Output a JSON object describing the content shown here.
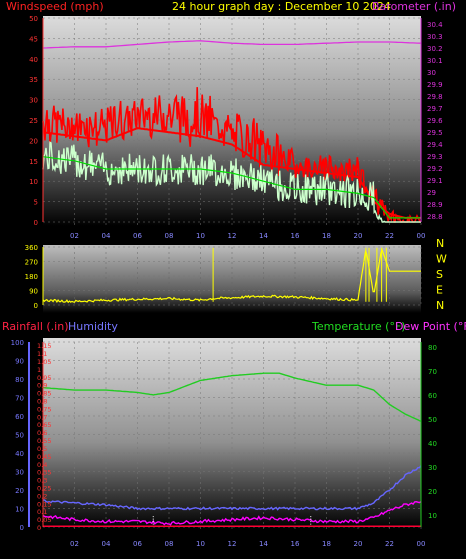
{
  "header": {
    "left_label": "Windspeed (mph)",
    "center_label": "24 hour graph day : December 10 2024",
    "right_label": "Barometer (.in)"
  },
  "colors": {
    "windspeed": "#ff0000",
    "gust": "#ff0000",
    "wind_avg": "#ccffcc",
    "wind_avg2": "#00dd00",
    "barometer": "#dd33dd",
    "direction": "#ffff00",
    "temperature": "#22cc22",
    "humidity": "#6666ff",
    "rainfall": "#ff0033",
    "dewpoint": "#ff00ff",
    "header_yellow": "#ffff00"
  },
  "chart_data": [
    {
      "type": "line",
      "x_ticks": [
        "02",
        "04",
        "06",
        "08",
        "10",
        "12",
        "14",
        "16",
        "18",
        "20",
        "22",
        "00"
      ],
      "left_axis": {
        "ticks": [
          0,
          5,
          10,
          15,
          20,
          25,
          30,
          35,
          40,
          45,
          50
        ],
        "range": [
          0,
          50
        ],
        "label": "Windspeed (mph)"
      },
      "right_axis": {
        "ticks": [
          "28.8",
          "28.9",
          "29",
          "29.1",
          "29.2",
          "29.3",
          "29.4",
          "29.5",
          "29.6",
          "29.7",
          "29.8",
          "29.9",
          "30",
          "30.1",
          "30.2",
          "30.3",
          "30.4"
        ],
        "range": [
          28.75,
          30.45
        ],
        "label": "Barometer (.in)"
      },
      "series": [
        {
          "name": "Windspeed (mph)",
          "hours": [
            0,
            2,
            4,
            6,
            8,
            10,
            12,
            14,
            16,
            18,
            20,
            21,
            22,
            23,
            24
          ],
          "values": [
            22,
            21,
            20,
            23,
            22,
            21,
            19,
            14,
            13,
            12,
            11,
            5,
            2,
            1,
            1
          ],
          "gust": [
            31,
            28,
            30,
            32,
            34,
            33,
            28,
            25,
            18,
            17,
            17,
            12,
            4,
            2,
            2
          ]
        },
        {
          "name": "Avg",
          "hours": [
            0,
            2,
            4,
            6,
            8,
            10,
            12,
            14,
            16,
            18,
            20,
            21,
            22,
            23,
            24
          ],
          "values": [
            16,
            15,
            13,
            13,
            13,
            13,
            12,
            10,
            8,
            8,
            7,
            6,
            1,
            1,
            1
          ]
        },
        {
          "name": "Barometer (.in)",
          "hours": [
            0,
            2,
            4,
            6,
            8,
            10,
            12,
            14,
            16,
            18,
            20,
            22,
            24
          ],
          "values": [
            30.2,
            30.21,
            30.21,
            30.23,
            30.25,
            30.26,
            30.24,
            30.23,
            30.23,
            30.24,
            30.25,
            30.25,
            30.24
          ]
        }
      ]
    },
    {
      "type": "line",
      "x_ticks": [],
      "left_axis": {
        "ticks": [
          0,
          90,
          180,
          270,
          360
        ],
        "range": [
          0,
          360
        ]
      },
      "compass": [
        "N",
        "W",
        "S",
        "E",
        "N"
      ],
      "series": [
        {
          "name": "Direction",
          "hours": [
            0,
            2,
            4,
            6,
            8,
            10,
            10.8,
            10.81,
            10.82,
            12,
            14,
            16,
            18,
            20,
            20.5,
            21,
            21.5,
            22,
            24
          ],
          "values": [
            30,
            22,
            30,
            36,
            40,
            30,
            40,
            350,
            40,
            45,
            55,
            50,
            40,
            30,
            350,
            60,
            350,
            210,
            210
          ]
        }
      ]
    },
    {
      "type": "line",
      "x_ticks": [
        "02",
        "04",
        "06",
        "08",
        "10",
        "12",
        "14",
        "16",
        "18",
        "20",
        "22",
        "00"
      ],
      "rain_axis": {
        "ticks": [
          "0",
          "0.05",
          "0.1",
          "0.15",
          "0.2",
          "0.25",
          "0.3",
          "0.35",
          "0.4",
          "0.45",
          "0.5",
          "0.55",
          "0.6",
          "0.65",
          "0.7",
          "0.75",
          "0.8",
          "0.85",
          "0.9",
          "0.95",
          "1",
          "1.05",
          "1.1",
          "1.15"
        ],
        "label": "Rainfall (.in)"
      },
      "humidity_axis": {
        "ticks": [
          0,
          10,
          20,
          30,
          40,
          50,
          60,
          70,
          80,
          90,
          100
        ],
        "label": "Humidity"
      },
      "temp_axis": {
        "ticks": [
          10,
          20,
          30,
          40,
          50,
          60,
          70,
          80
        ],
        "label": "Temperature (°F)"
      },
      "dewpoint_label": "Dew Point (°F)",
      "series": [
        {
          "name": "Temperature (°F)",
          "hours": [
            0,
            2,
            4,
            6,
            7,
            8,
            10,
            12,
            14,
            15,
            16,
            18,
            20,
            21,
            22,
            23,
            24
          ],
          "values": [
            63,
            62,
            62,
            61,
            60,
            61,
            66,
            68,
            69,
            69,
            67,
            64,
            64,
            62,
            56,
            52,
            49
          ]
        },
        {
          "name": "Humidity",
          "hours": [
            0,
            2,
            4,
            6,
            8,
            10,
            12,
            14,
            16,
            18,
            20,
            21,
            22,
            23,
            24
          ],
          "values": [
            14,
            13,
            12,
            10,
            10,
            10,
            10,
            10,
            10,
            10,
            10,
            13,
            20,
            28,
            33
          ]
        },
        {
          "name": "Dew Point (°F)",
          "hours": [
            0,
            2,
            4,
            6,
            8,
            10,
            12,
            14,
            16,
            18,
            20,
            21,
            22,
            23,
            24
          ],
          "values": [
            6,
            4,
            3,
            3,
            2,
            3,
            4,
            5,
            4,
            3,
            3,
            5,
            9,
            12,
            14
          ]
        }
      ]
    }
  ]
}
